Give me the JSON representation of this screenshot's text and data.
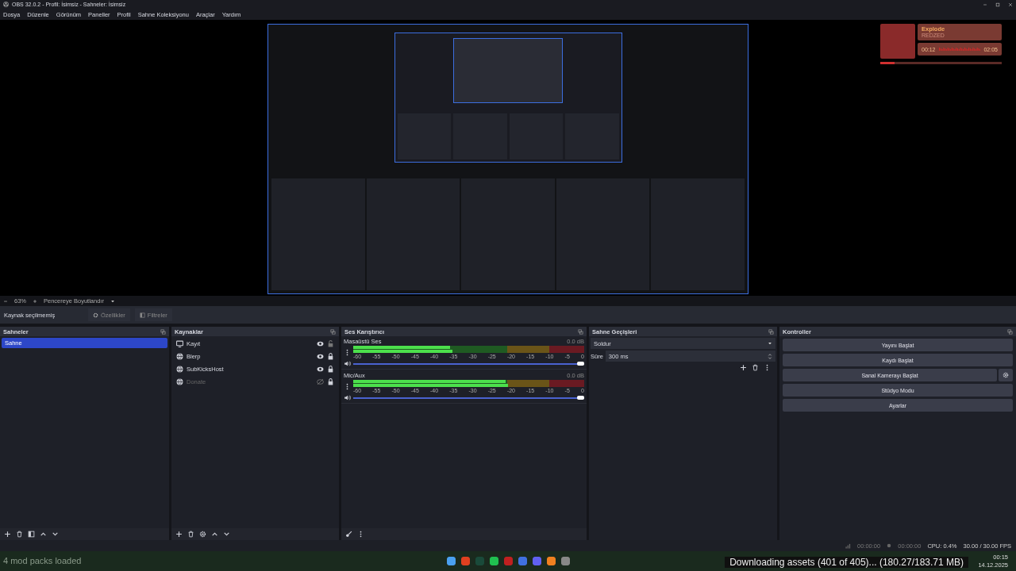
{
  "window": {
    "title": "OBS 32.0.2 - Profil: İsimsiz - Sahneler: İsimsiz"
  },
  "menu": [
    "Dosya",
    "Düzenle",
    "Görünüm",
    "Paneller",
    "Profil",
    "Sahne Koleksiyonu",
    "Araçlar",
    "Yardım"
  ],
  "now_playing": {
    "title": "Explode",
    "artist": "REDZED",
    "elapsed": "00:12",
    "duration": "02:05",
    "progress": {
      "level": 0.12
    }
  },
  "zoom_bar": {
    "zoom": "63%",
    "fit": "Pencereye Boyutlandır"
  },
  "source_bar": {
    "status": "Kaynak seçilmemiş",
    "buttons": [
      {
        "label": "Özellikler",
        "kind": "properties"
      },
      {
        "label": "Filtreler",
        "kind": "filters"
      }
    ]
  },
  "scenes": {
    "title": "Sahneler",
    "items": [
      {
        "name": "Sahne",
        "selected": true
      }
    ]
  },
  "sources": {
    "title": "Kaynaklar",
    "items": [
      {
        "name": "Kayıt",
        "kind": "display",
        "visible": true,
        "locked": false
      },
      {
        "name": "Blerp",
        "kind": "browser",
        "visible": true,
        "locked": true
      },
      {
        "name": "SubKicksHost",
        "kind": "browser",
        "visible": true,
        "locked": true
      },
      {
        "name": "Donate",
        "kind": "browser",
        "visible": false,
        "locked": true
      }
    ]
  },
  "mixer": {
    "title": "Ses Karıştırıcı",
    "channels": [
      {
        "name": "Masaüstü Ses",
        "reading": "0.0 dB",
        "meter": {
          "level": 0.42
        },
        "level": 1,
        "ticks": [
          "-60",
          "-55",
          "-50",
          "-45",
          "-40",
          "-35",
          "-30",
          "-25",
          "-20",
          "-15",
          "-10",
          "-5",
          "0"
        ]
      },
      {
        "name": "Mic/Aux",
        "reading": "0.0 dB",
        "meter": {
          "level": 0.66
        },
        "level": 1,
        "ticks": [
          "-60",
          "-55",
          "-50",
          "-45",
          "-40",
          "-35",
          "-30",
          "-25",
          "-20",
          "-15",
          "-10",
          "-5",
          "0"
        ]
      }
    ]
  },
  "transitions": {
    "title": "Sahne Geçişleri",
    "selected": "Soldur",
    "duration_label": "Süre",
    "duration": "300 ms"
  },
  "controls": {
    "title": "Kontroller",
    "buttons": [
      {
        "label": "Yayını Başlat",
        "kind": "plain"
      },
      {
        "label": "Kaydı Başlat",
        "kind": "plain"
      },
      {
        "label": "Sanal Kamerayı Başlat",
        "kind": "with_settings"
      },
      {
        "label": "Stüdyo Modu",
        "kind": "plain"
      },
      {
        "label": "Ayarlar",
        "kind": "plain"
      }
    ]
  },
  "status_bar": {
    "stream_time": "00:00:00",
    "record_time": "00:00:00",
    "cpu": "CPU: 0.4%",
    "fps": "30.00 / 30.00 FPS"
  },
  "overlays": {
    "mod_status": "4 mod packs loaded",
    "download": "Downloading assets (401 of 405)... (180.27/183.71 MB)"
  },
  "taskbar": {
    "time": "00:15",
    "date": "14.12.2025"
  }
}
